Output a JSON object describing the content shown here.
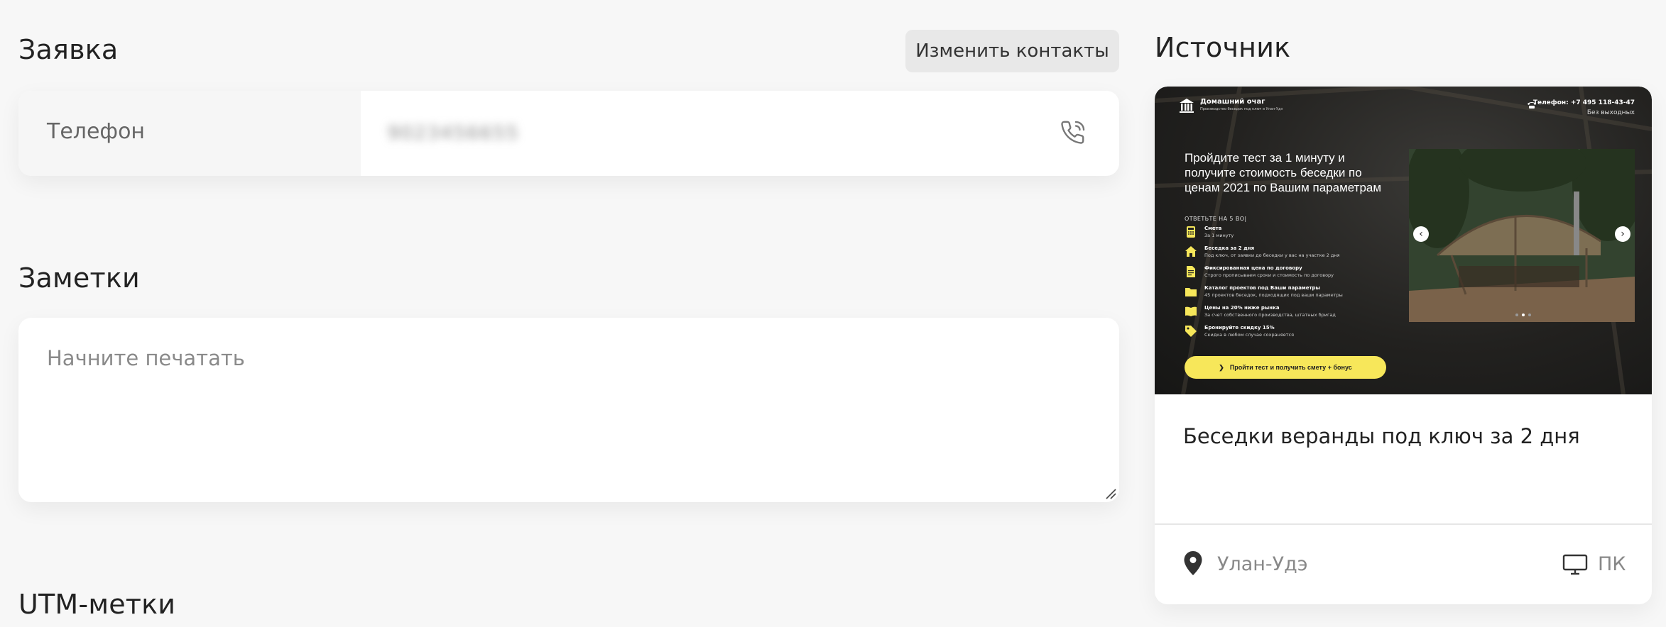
{
  "request": {
    "title": "Заявка",
    "change_contacts_label": "Изменить контакты",
    "phone_label": "Телефон",
    "phone_value": "9023456655"
  },
  "notes": {
    "title": "Заметки",
    "placeholder": "Начните печатать"
  },
  "utm": {
    "title": "UTM-метки"
  },
  "source": {
    "title": "Источник",
    "page_title": "Беседки веранды под ключ за 2 дня",
    "city": "Улан-Удэ",
    "device": "ПК",
    "preview": {
      "logo_name": "Домашний очаг",
      "logo_sub": "Производство беседок под ключ в Улан-Удэ",
      "phone": "Телефон: +7 495 118-43-47",
      "schedule": "Без выходных",
      "headline": "Пройдите тест за 1 минуту и получите стоимость беседки по ценам 2021 по Вашим параметрам",
      "answer_hint": "ОТВЕТЬТЕ НА 5 ВО|",
      "features": [
        {
          "icon": "calculator-icon",
          "title": "Смета",
          "sub": "За 1 минуту"
        },
        {
          "icon": "house-icon",
          "title": "Беседка за 2 дня",
          "sub": "Под ключ, от заявки до беседки у вас на участке 2 дня"
        },
        {
          "icon": "document-icon",
          "title": "Фиксированная цена по договору",
          "sub": "Строго прописываем сроки и стоимость по договору"
        },
        {
          "icon": "folder-icon",
          "title": "Каталог проектов под Ваши параметры",
          "sub": "45 проектов беседок, подходящих под ваши параметры"
        },
        {
          "icon": "book-icon",
          "title": "Цены на 20% ниже рынка",
          "sub": "За счет собственного производства, штатных бригад"
        },
        {
          "icon": "tag-icon",
          "title": "Бронируйте скидку 15%",
          "sub": "Скидка в любом случае сохраняется"
        }
      ],
      "cta": "Пройти тест и получить смету + бонус"
    }
  },
  "colors": {
    "background": "#f7f7f7",
    "accent_yellow": "#f7e75a"
  }
}
